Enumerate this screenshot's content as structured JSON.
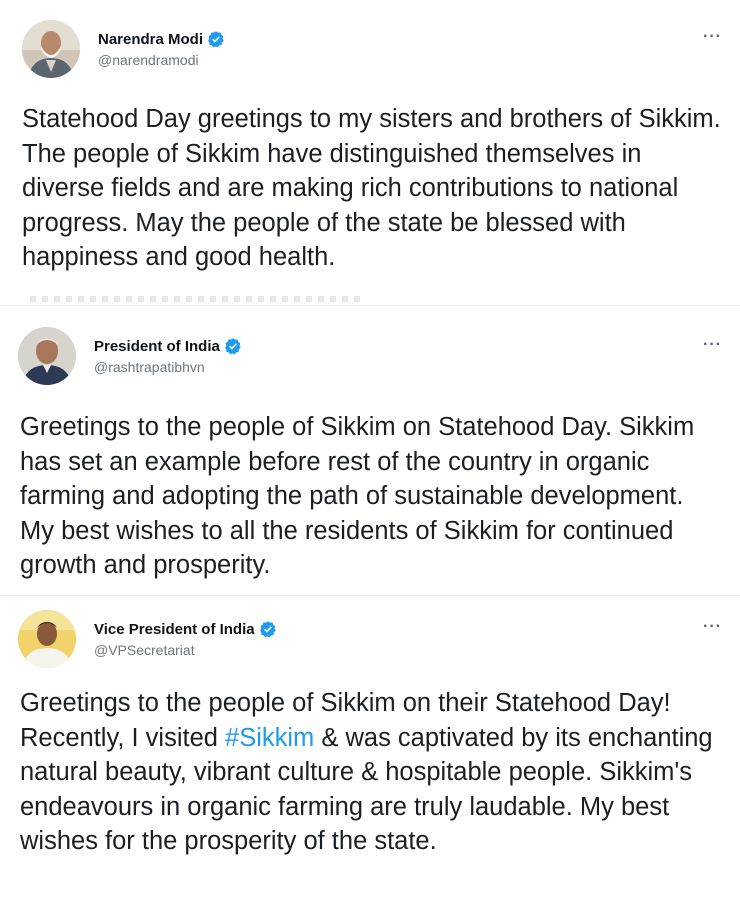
{
  "tweets": [
    {
      "display_name": "Narendra Modi",
      "handle": "@narendramodi",
      "verified_icon": "verified-badge-icon",
      "more_label": "···",
      "text": "Statehood Day greetings to my sisters and brothers of Sikkim. The people of Sikkim have distinguished themselves in diverse fields and are making rich contributions to national progress. May the people of the state be blessed with happiness and good health."
    },
    {
      "display_name": "President of India",
      "handle": "@rashtrapatibhvn",
      "verified_icon": "verified-badge-icon",
      "more_label": "···",
      "text": "Greetings to the people of Sikkim on Statehood Day. Sikkim has set an example before rest of the country in organic farming and adopting the path of sustainable development. My best wishes to all the residents of Sikkim for continued growth and prosperity."
    },
    {
      "display_name": "Vice President of India",
      "handle": "@VPSecretariat",
      "verified_icon": "verified-badge-icon",
      "more_label": "···",
      "text_before": "Greetings to the people of Sikkim on their Statehood Day! Recently, I visited ",
      "hashtag": "#Sikkim",
      "text_after": " & was captivated by its enchanting natural beauty, vibrant culture & hospitable people. Sikkim's endeavours in organic farming are truly laudable. My best wishes for the prosperity of the state."
    }
  ],
  "colors": {
    "verified": "#1d9bf0",
    "hashtag": "#1d9bf0",
    "handle": "#6e767d"
  }
}
